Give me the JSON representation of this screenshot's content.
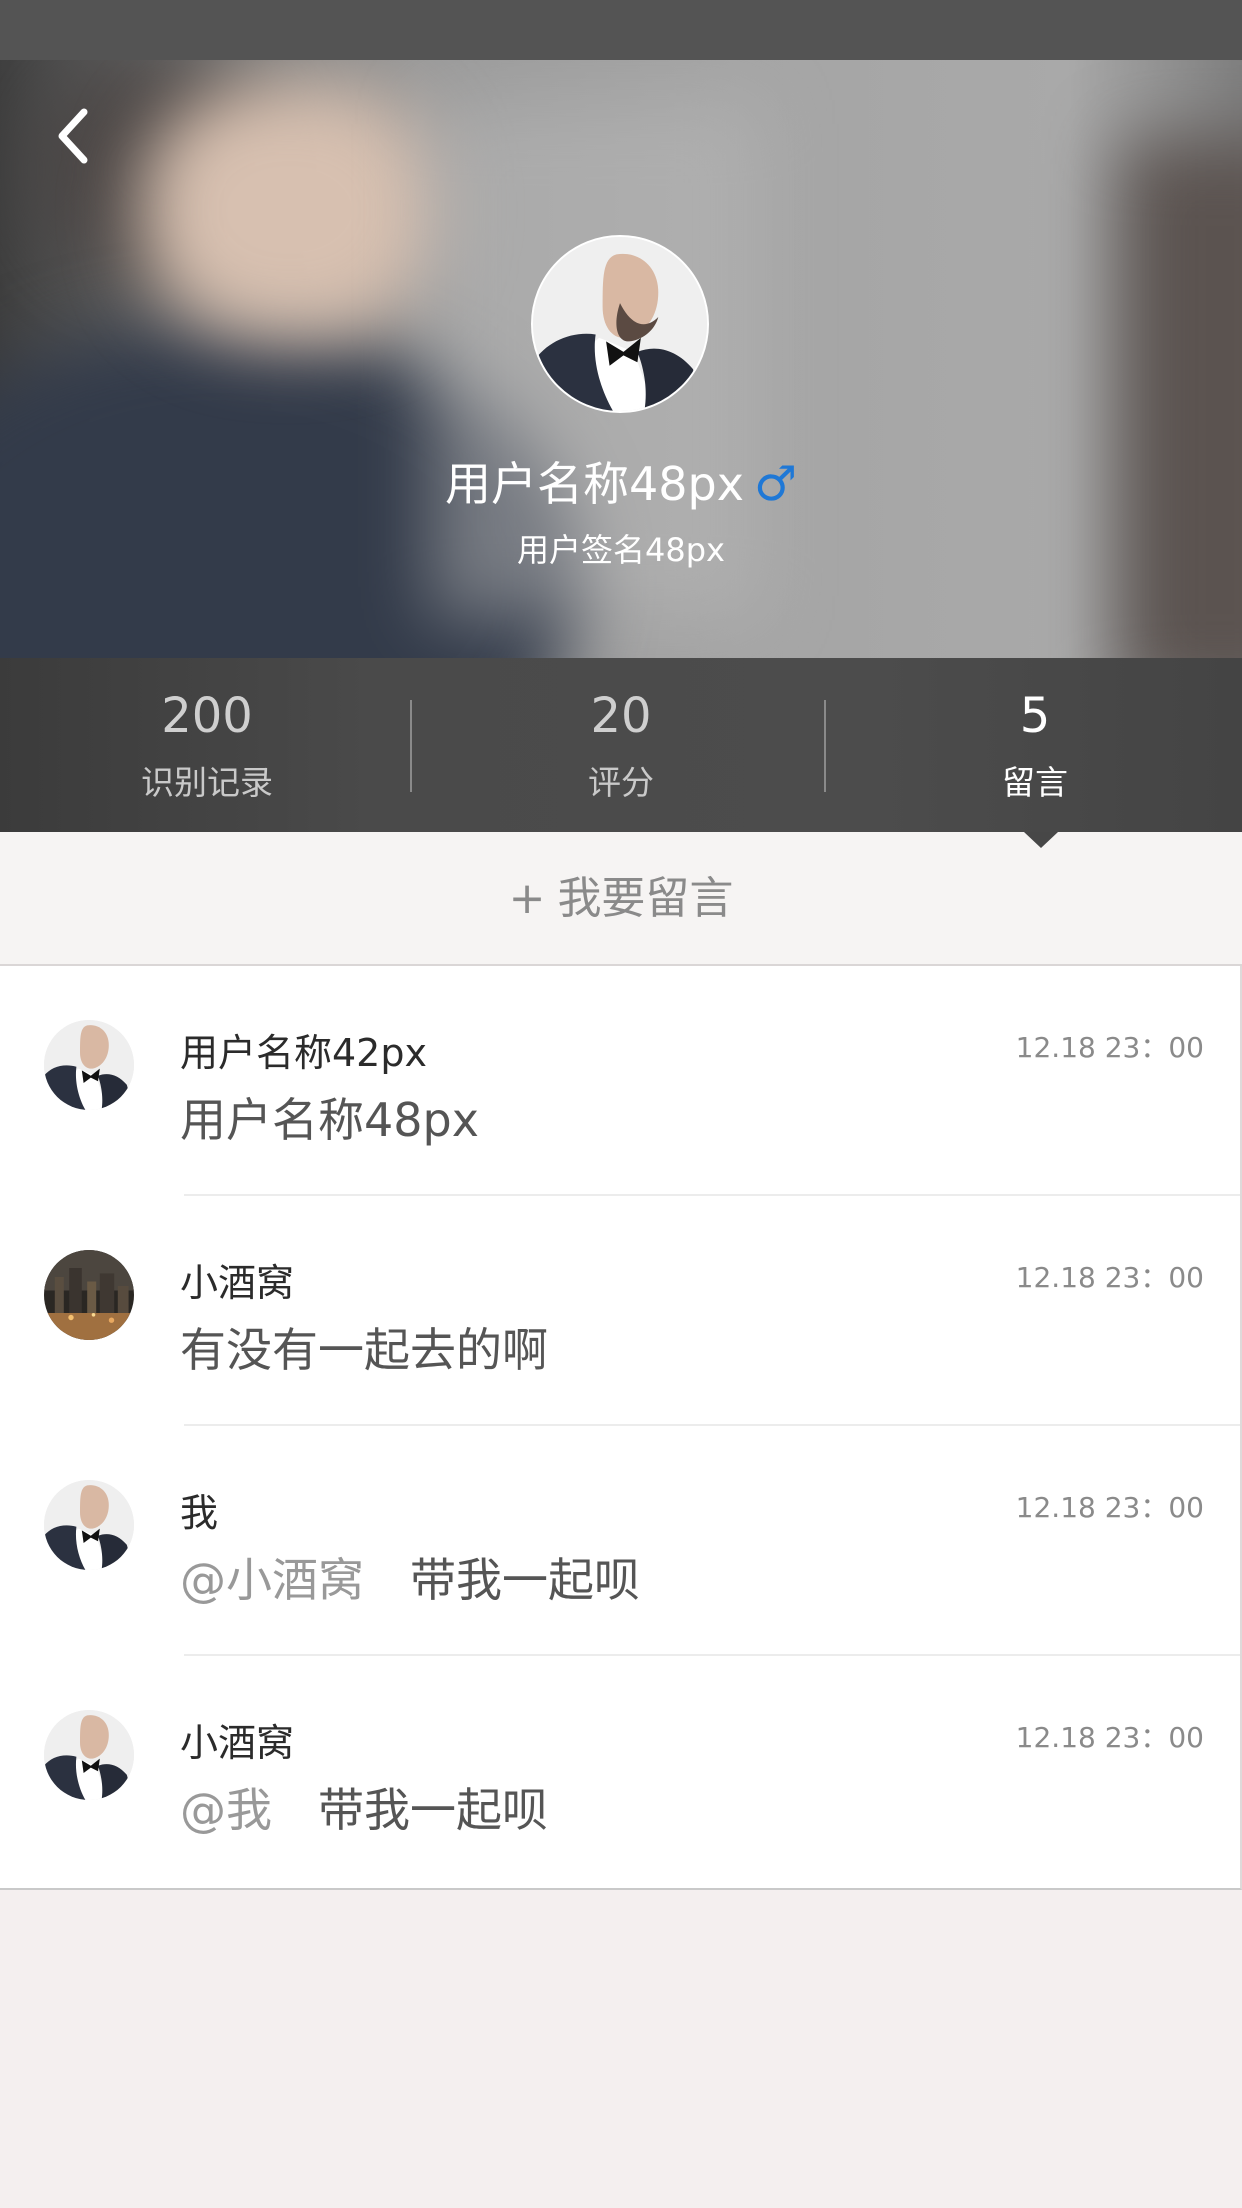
{
  "profile": {
    "name": "用户名称48px",
    "gender_symbol": "♂",
    "signature": "用户签名48px"
  },
  "stats": [
    {
      "value": "200",
      "label": "识别记录"
    },
    {
      "value": "20",
      "label": "评分"
    },
    {
      "value": "5",
      "label": "留言"
    }
  ],
  "active_tab": "留言",
  "leave_message": {
    "plus": "+",
    "label": "我要留言"
  },
  "messages": [
    {
      "name": "用户名称42px",
      "time": "12.18 23：00",
      "mention": "",
      "text": "用户名称48px",
      "avatar": "man-avatar-icon"
    },
    {
      "name": "小酒窝",
      "time": "12.18 23：00",
      "mention": "",
      "text": "有没有一起去的啊",
      "avatar": "city-night-avatar-icon"
    },
    {
      "name": "我",
      "time": "12.18 23：00",
      "mention": "@小酒窝",
      "text": "带我一起呗",
      "avatar": "man-avatar-icon"
    },
    {
      "name": "小酒窝",
      "time": "12.18 23：00",
      "mention": "@我",
      "text": "带我一起呗",
      "avatar": "man-avatar-icon"
    }
  ],
  "colors": {
    "status_bar": "#545454",
    "stats_bar": "#4a4a4a",
    "gender_male": "#1f78d6",
    "page_background": "#f4efef"
  },
  "icons": {
    "back": "back-arrow-icon",
    "gender": "male-icon"
  }
}
